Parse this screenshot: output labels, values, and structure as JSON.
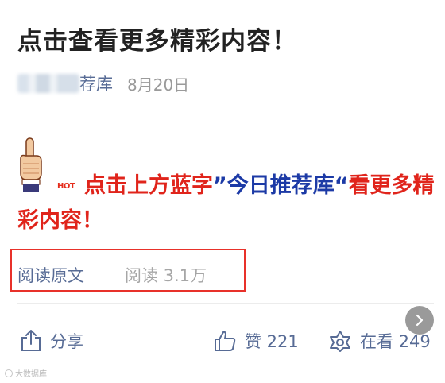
{
  "article": {
    "title": "点击查看更多精彩内容！",
    "account_name_tail": "荐库",
    "date": "8月20日"
  },
  "promo": {
    "hot_badge": "HOT",
    "headline_part1": "点击上方蓝字",
    "headline_part2": "”今日推荐库“",
    "headline_part3": "看更多精彩内容！"
  },
  "footer": {
    "read_original": "阅读原文",
    "read_count": "阅读 3.1万",
    "share_label": "分享",
    "like_label": "赞 221",
    "watching_label": "在看 249"
  },
  "watermark": {
    "text": "大数据库"
  },
  "colors": {
    "link_blue": "#576b95",
    "headline_red": "#e0241b",
    "headline_blue": "#1c3aa6",
    "highlight_border": "#e8312a"
  },
  "icons": {
    "hand": "pointing-up-hand-icon",
    "share": "share-icon",
    "like": "thumbs-up-icon",
    "watching": "flower-icon",
    "next": "chevron-right-icon"
  }
}
